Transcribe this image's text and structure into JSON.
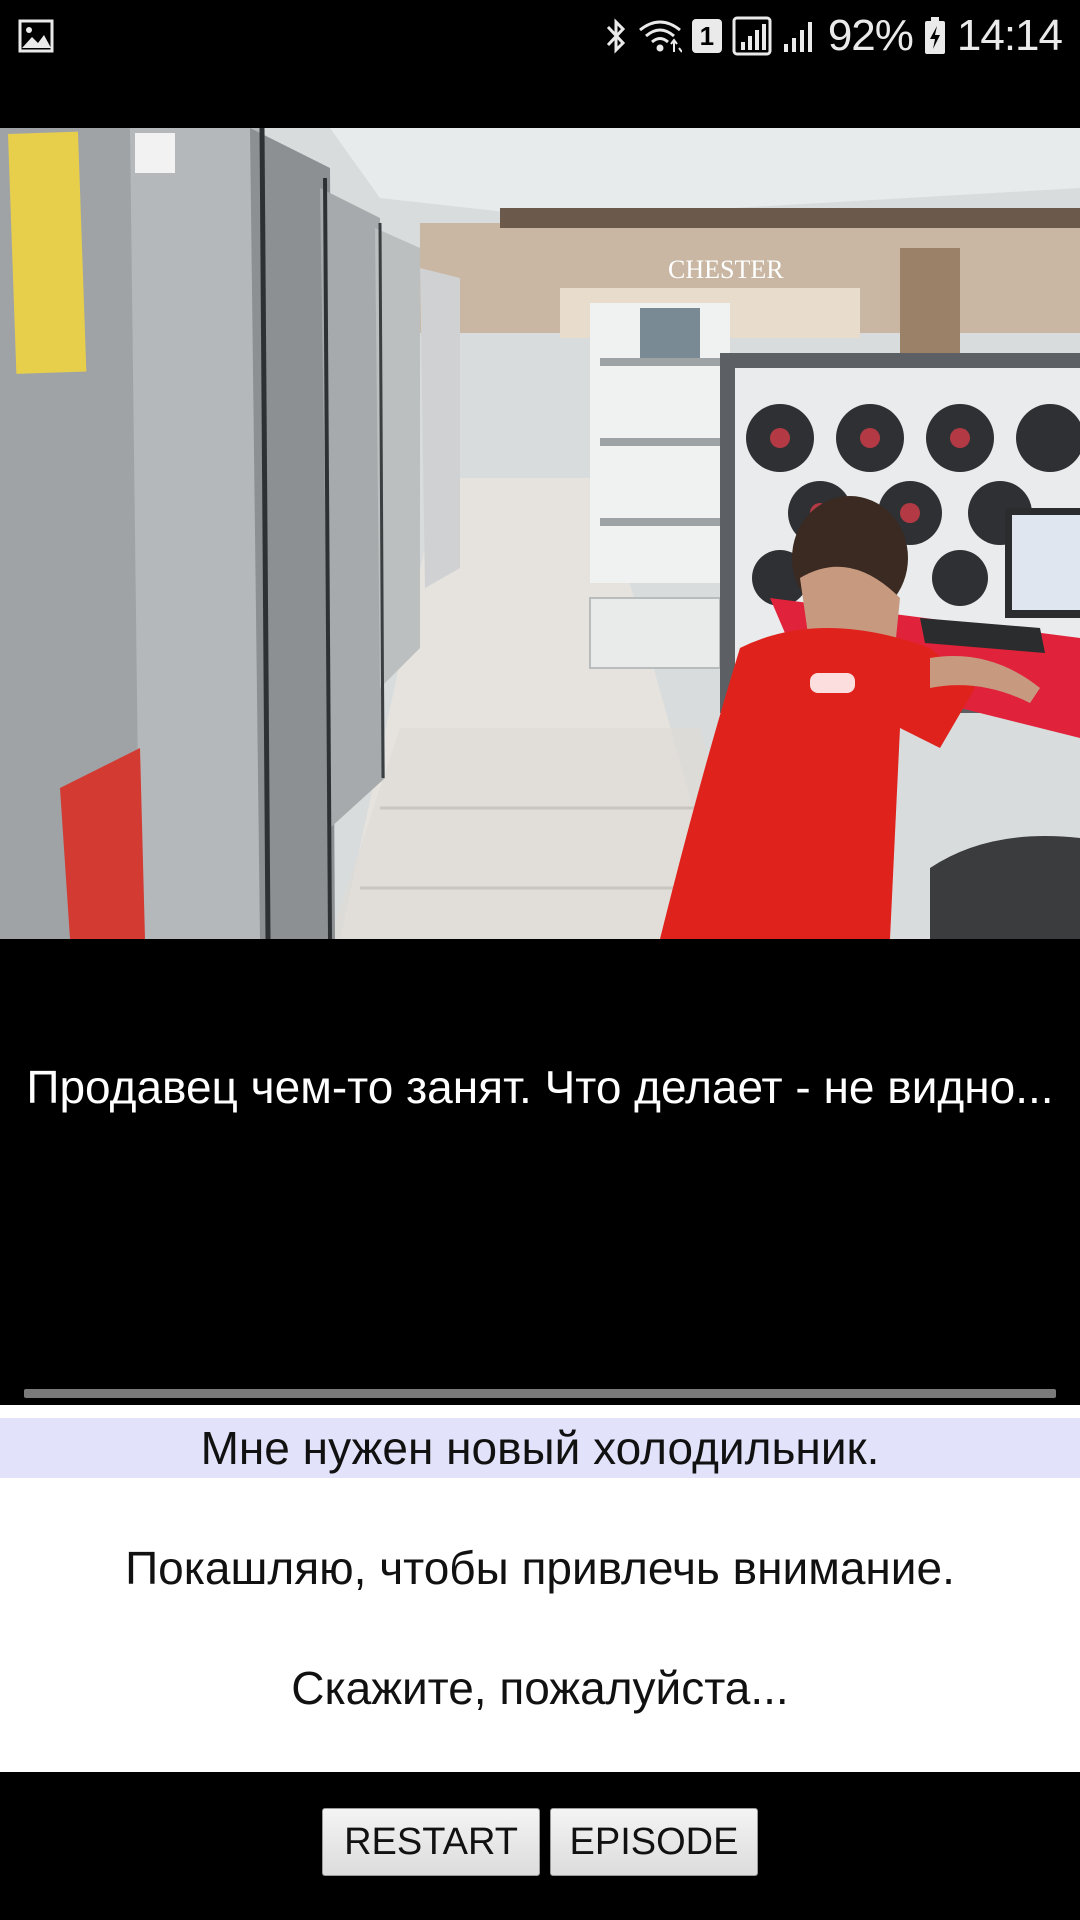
{
  "status_bar": {
    "battery": "92%",
    "time": "14:14",
    "sim_badge": "1",
    "left_icon": "gallery-icon",
    "icons": [
      "bluetooth-icon",
      "wifi-icon",
      "signal-icon",
      "signal-icon",
      "battery-icon"
    ]
  },
  "scene": {
    "store_sign": "CHESTER"
  },
  "narration": "Продавец чем-то занят. Что делает - не видно...",
  "choices": [
    {
      "label": "Мне нужен новый холодильник.",
      "selected": true
    },
    {
      "label": "Покашляю, чтобы привлечь внимание.",
      "selected": false
    },
    {
      "label": "Скажите, пожалуйста...",
      "selected": false
    }
  ],
  "buttons": {
    "restart": "RESTART",
    "episode": "EPISODE"
  },
  "colors": {
    "selected_choice_bg": "#e2e3fb",
    "shirt_red": "#e0221c"
  }
}
